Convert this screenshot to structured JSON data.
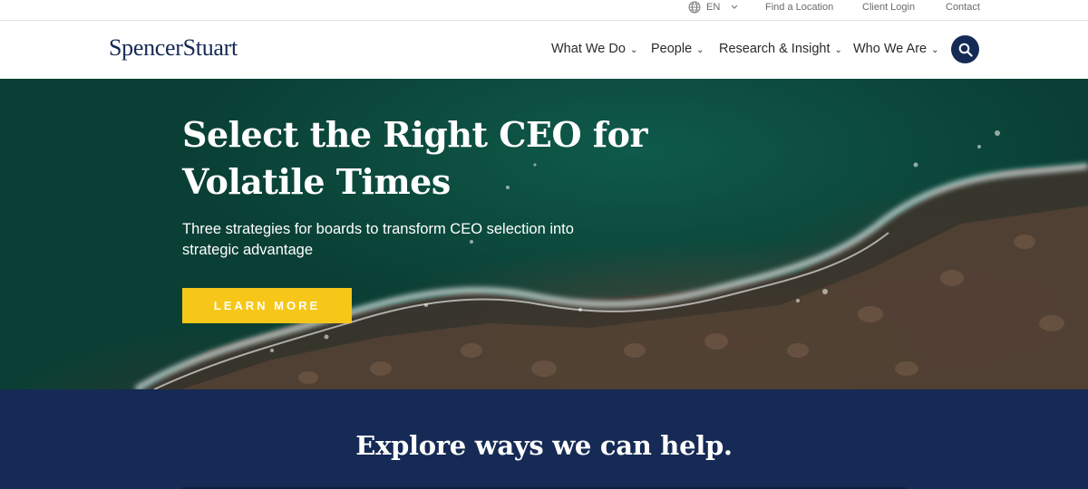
{
  "utility": {
    "language": "EN",
    "links": [
      "Find a Location",
      "Client Login",
      "Contact"
    ]
  },
  "brand": {
    "logo_text": "SpencerStuart",
    "primary_color": "#152a54",
    "accent_color": "#f6c718"
  },
  "nav": {
    "items": [
      "What We Do",
      "People",
      "Research & Insight",
      "Who We Are"
    ],
    "search_icon": "search-icon"
  },
  "hero": {
    "title": "Select the Right CEO for Volatile Times",
    "subtitle": "Three strategies for boards to transform CEO selection into strategic advantage",
    "cta": "LEARN MORE"
  },
  "explore": {
    "title": "Explore ways we can help."
  }
}
